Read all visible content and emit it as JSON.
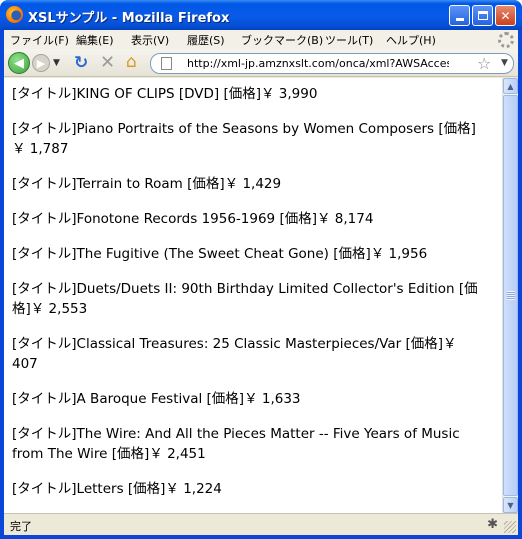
{
  "window": {
    "title": "XSLサンプル - Mozilla Firefox"
  },
  "menubar": {
    "items": [
      "ファイル(F)",
      "編集(E)",
      "表示(V)",
      "履歴(S)",
      "ブックマーク(B)",
      "ツール(T)",
      "ヘルプ(H)"
    ]
  },
  "navbar": {
    "url": "http://xml-jp.amznxslt.com/onca/xml?AWSAccessKeyId"
  },
  "products": [
    "[タイトル]KING OF CLIPS [DVD] [価格]￥ 3,990",
    "[タイトル]Piano Portraits of the Seasons by Women Composers [価格]￥ 1,787",
    "[タイトル]Terrain to Roam [価格]￥ 1,429",
    "[タイトル]Fonotone Records 1956-1969 [価格]￥ 8,174",
    "[タイトル]The Fugitive (The Sweet Cheat Gone) [価格]￥ 1,956",
    "[タイトル]Duets/Duets II: 90th Birthday Limited Collector's Edition [価格]￥ 2,553",
    "[タイトル]Classical Treasures: 25 Classic Masterpieces/Var [価格]￥ 407",
    "[タイトル]A Baroque Festival [価格]￥ 1,633",
    "[タイトル]The Wire: And All the Pieces Matter -- Five Years of Music from The Wire [価格]￥ 2,451",
    "[タイトル]Letters [価格]￥ 1,224"
  ],
  "statusbar": {
    "text": "完了"
  },
  "icons": {
    "app": "firefox-logo-icon",
    "back": "back-arrow-icon",
    "forward": "forward-arrow-icon",
    "reload": "reload-icon",
    "stop": "stop-icon",
    "home": "home-icon",
    "page": "page-icon",
    "bookmark": "star-icon"
  }
}
